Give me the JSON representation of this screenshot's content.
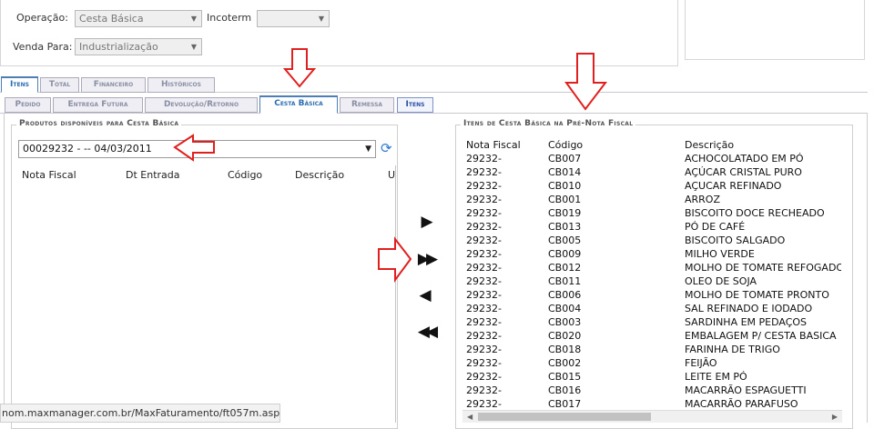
{
  "header": {
    "operacao_label": "Operação:",
    "operacao_value": "Cesta Básica",
    "incoterm_label": "Incoterm",
    "incoterm_value": "",
    "venda_label": "Venda Para:",
    "venda_value": "Industrialização"
  },
  "tabs_main": [
    "Itens",
    "Total",
    "Financeiro",
    "Históricos"
  ],
  "tabs_sub": [
    "Pedido",
    "Entrega Futura",
    "Devolução/Retorno",
    "Cesta Básica",
    "Remessa",
    "Itens"
  ],
  "left_panel": {
    "legend": "Produtos disponíveis para Cesta Básica",
    "combo_value": "00029232 - -- 04/03/2011",
    "columns": [
      "Nota Fiscal",
      "Dt Entrada",
      "Código",
      "Descrição",
      "U"
    ]
  },
  "buttons": {
    "add_one": "▶",
    "add_all": "▶▶",
    "remove_one": "◀",
    "remove_all": "◀◀"
  },
  "right_panel": {
    "legend": "Itens de Cesta Básica na Pré-Nota Fiscal",
    "columns": [
      "Nota Fiscal",
      "Código",
      "Descrição"
    ],
    "rows": [
      {
        "nf": "29232-",
        "cod": "CB007",
        "desc": "ACHOCOLATADO EM PÓ"
      },
      {
        "nf": "29232-",
        "cod": "CB014",
        "desc": "AÇÚCAR CRISTAL PURO"
      },
      {
        "nf": "29232-",
        "cod": "CB010",
        "desc": "AÇUCAR REFINADO"
      },
      {
        "nf": "29232-",
        "cod": "CB001",
        "desc": "ARROZ"
      },
      {
        "nf": "29232-",
        "cod": "CB019",
        "desc": "BISCOITO DOCE RECHEADO"
      },
      {
        "nf": "29232-",
        "cod": "CB013",
        "desc": "PÓ DE CAFÉ"
      },
      {
        "nf": "29232-",
        "cod": "CB005",
        "desc": "BISCOITO SALGADO"
      },
      {
        "nf": "29232-",
        "cod": "CB009",
        "desc": "MILHO VERDE"
      },
      {
        "nf": "29232-",
        "cod": "CB012",
        "desc": "MOLHO DE TOMATE REFOGADO"
      },
      {
        "nf": "29232-",
        "cod": "CB011",
        "desc": "OLEO DE SOJA"
      },
      {
        "nf": "29232-",
        "cod": "CB006",
        "desc": "MOLHO DE TOMATE PRONTO"
      },
      {
        "nf": "29232-",
        "cod": "CB004",
        "desc": "SAL REFINADO E IODADO"
      },
      {
        "nf": "29232-",
        "cod": "CB003",
        "desc": "SARDINHA EM PEDAÇOS"
      },
      {
        "nf": "29232-",
        "cod": "CB020",
        "desc": "EMBALAGEM P/ CESTA BASICA"
      },
      {
        "nf": "29232-",
        "cod": "CB018",
        "desc": "FARINHA DE TRIGO"
      },
      {
        "nf": "29232-",
        "cod": "CB002",
        "desc": "FEIJÃO"
      },
      {
        "nf": "29232-",
        "cod": "CB015",
        "desc": "LEITE EM PÓ"
      },
      {
        "nf": "29232-",
        "cod": "CB016",
        "desc": "MACARRÃO ESPAGUETTI"
      },
      {
        "nf": "29232-",
        "cod": "CB017",
        "desc": "MACARRÃO PARAFUSO"
      }
    ]
  },
  "status_bar": "nom.maxmanager.com.br/MaxFaturamento/ft057m.aspx#",
  "icons": {
    "refresh": "refresh-icon",
    "dropdown": "chevron-down-icon",
    "annotation": "red-arrow-annotation"
  },
  "colors": {
    "active_tab": "#2a6db0",
    "annotation_red": "#e01f1f",
    "refresh_blue": "#2e7bd4"
  }
}
